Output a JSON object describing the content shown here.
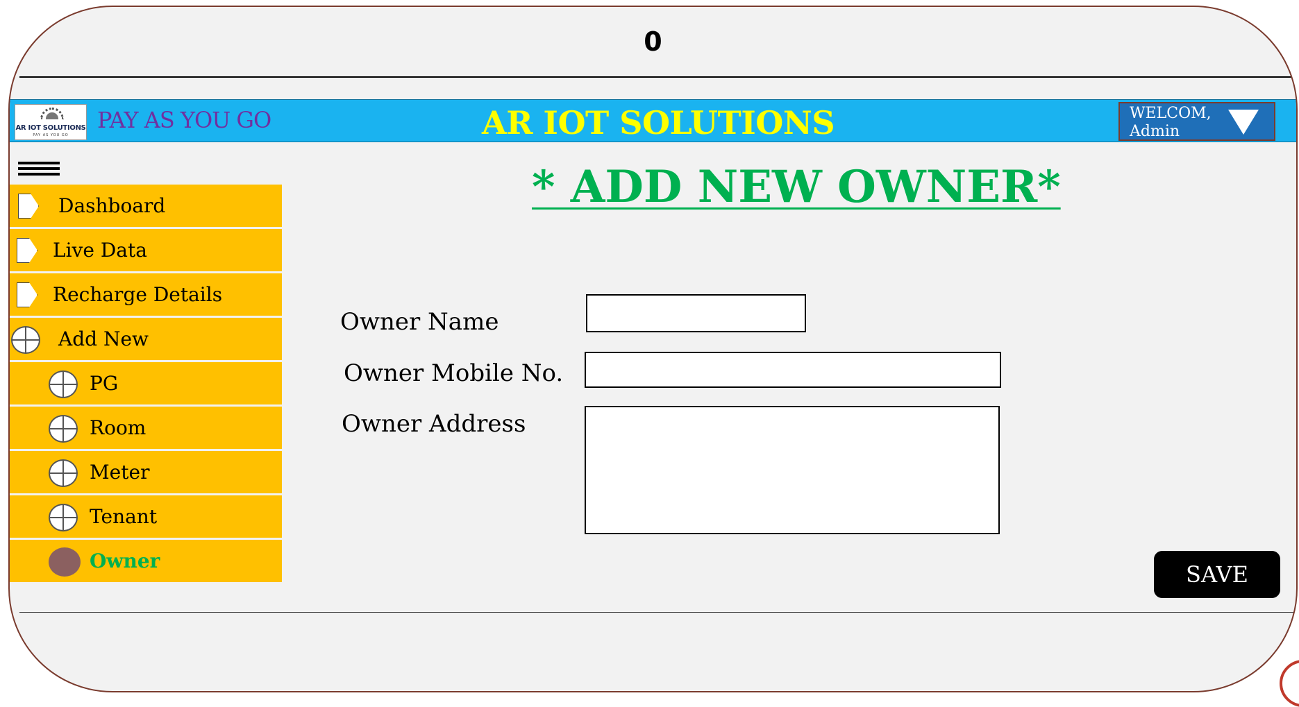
{
  "top_indicator": "0",
  "header": {
    "logo_text": "AR IOT SOLUTIONS",
    "logo_subtext": "PAY AS YOU GO",
    "tagline": "PAY AS YOU GO",
    "brand": "AR IOT SOLUTIONS",
    "welcome_line1": "WELCOM,",
    "welcome_line2": "Admin",
    "colors": {
      "bar": "#1ab3f0",
      "brand": "#ffff00",
      "tagline": "#7030a0",
      "welcome_bg": "#1f6fb8"
    }
  },
  "sidebar": {
    "menu_icon": "hamburger-icon",
    "items": [
      {
        "label": "Dashboard",
        "icon": "chevron-right-icon"
      },
      {
        "label": "Live Data",
        "icon": "chevron-right-icon"
      },
      {
        "label": "Recharge Details",
        "icon": "chevron-right-icon"
      },
      {
        "label": "Add New",
        "icon": "crosshair-circle-icon"
      },
      {
        "label": "PG",
        "icon": "crosshair-circle-icon"
      },
      {
        "label": "Room",
        "icon": "crosshair-circle-icon"
      },
      {
        "label": "Meter",
        "icon": "crosshair-circle-icon"
      },
      {
        "label": "Tenant",
        "icon": "crosshair-circle-icon"
      },
      {
        "label": "Owner",
        "icon": "filled-circle-icon",
        "active": true
      }
    ],
    "colors": {
      "item_bg": "#ffc000",
      "active_text": "#00b050"
    }
  },
  "main": {
    "title": "* ADD NEW OWNER*",
    "form": {
      "owner_name_label": "Owner Name",
      "owner_name_value": "",
      "owner_mobile_label": "Owner Mobile No.",
      "owner_mobile_value": "",
      "owner_address_label": "Owner Address",
      "owner_address_value": ""
    },
    "save_label": "SAVE"
  }
}
